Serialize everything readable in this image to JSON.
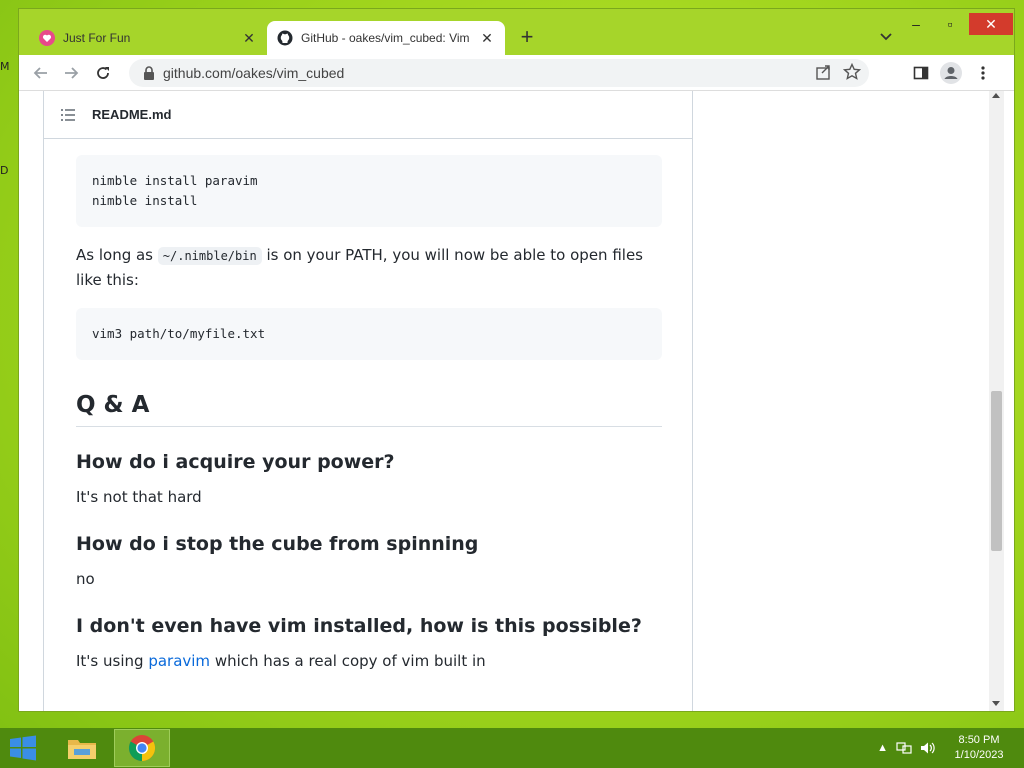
{
  "desktop": {
    "icon_labels": [
      "M",
      "D"
    ]
  },
  "browser": {
    "tabs": [
      {
        "title": "Just For Fun",
        "active": false
      },
      {
        "title": "GitHub - oakes/vim_cubed: Vim",
        "active": true
      }
    ],
    "new_tab_label": "+",
    "url": "github.com/oakes/vim_cubed"
  },
  "readme": {
    "filename": "README.md",
    "code_install": "nimble install paravim\nnimble install",
    "para1_before": "As long as ",
    "para1_code": "~/.nimble/bin",
    "para1_after": " is on your PATH, you will now be able to open files like this:",
    "code_open": "vim3 path/to/myfile.txt",
    "qa_heading": "Q & A",
    "questions": [
      {
        "q": "How do i acquire your power?",
        "a": "It's not that hard"
      },
      {
        "q": "How do i stop the cube from spinning",
        "a": "no"
      },
      {
        "q": "I don't even have vim installed, how is this possible?",
        "a_before": "It's using ",
        "a_link": "paravim",
        "a_after": " which has a real copy of vim built in"
      }
    ]
  },
  "taskbar": {
    "time": "8:50 PM",
    "date": "1/10/2023"
  },
  "colors": {
    "link": "#0969da",
    "tabstrip": "#a6d52a",
    "taskbar": "#4f8a0e"
  }
}
